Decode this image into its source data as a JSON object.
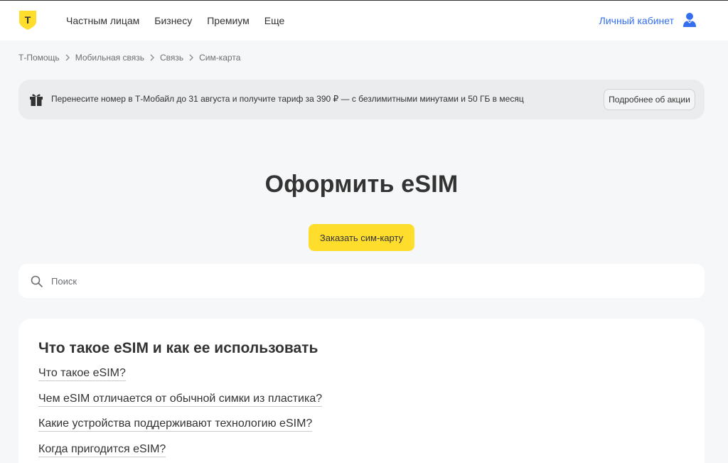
{
  "header": {
    "logo_letter": "Т",
    "nav": [
      "Частным лицам",
      "Бизнесу",
      "Премиум",
      "Еще"
    ],
    "account_label": "Личный кабинет"
  },
  "breadcrumb": [
    "Т-Помощь",
    "Мобильная связь",
    "Связь",
    "Сим-карта"
  ],
  "promo": {
    "text": "Перенесите номер в Т-Мобайл до 31 августа и получите тариф за 390 ₽ — с безлимитными минутами и 50 ГБ в месяц",
    "button_label": "Подробнее об акции"
  },
  "main": {
    "title": "Оформить eSIM",
    "order_button": "Заказать сим-карту"
  },
  "search": {
    "placeholder": "Поиск",
    "value": ""
  },
  "faq": {
    "heading": "Что такое eSIM и как ее использовать",
    "items": [
      "Что такое eSIM?",
      "Чем eSIM отличается от обычной симки из пластика?",
      "Какие устройства поддерживают технологию eSIM?",
      "Когда пригодится eSIM?"
    ]
  },
  "colors": {
    "accent_yellow": "#ffdd2d",
    "link_blue": "#336fee",
    "page_bg": "#f6f7f8"
  },
  "icons": [
    "t-logo-icon",
    "user-avatar-icon",
    "chevron-right-icon",
    "gift-icon",
    "search-icon"
  ]
}
